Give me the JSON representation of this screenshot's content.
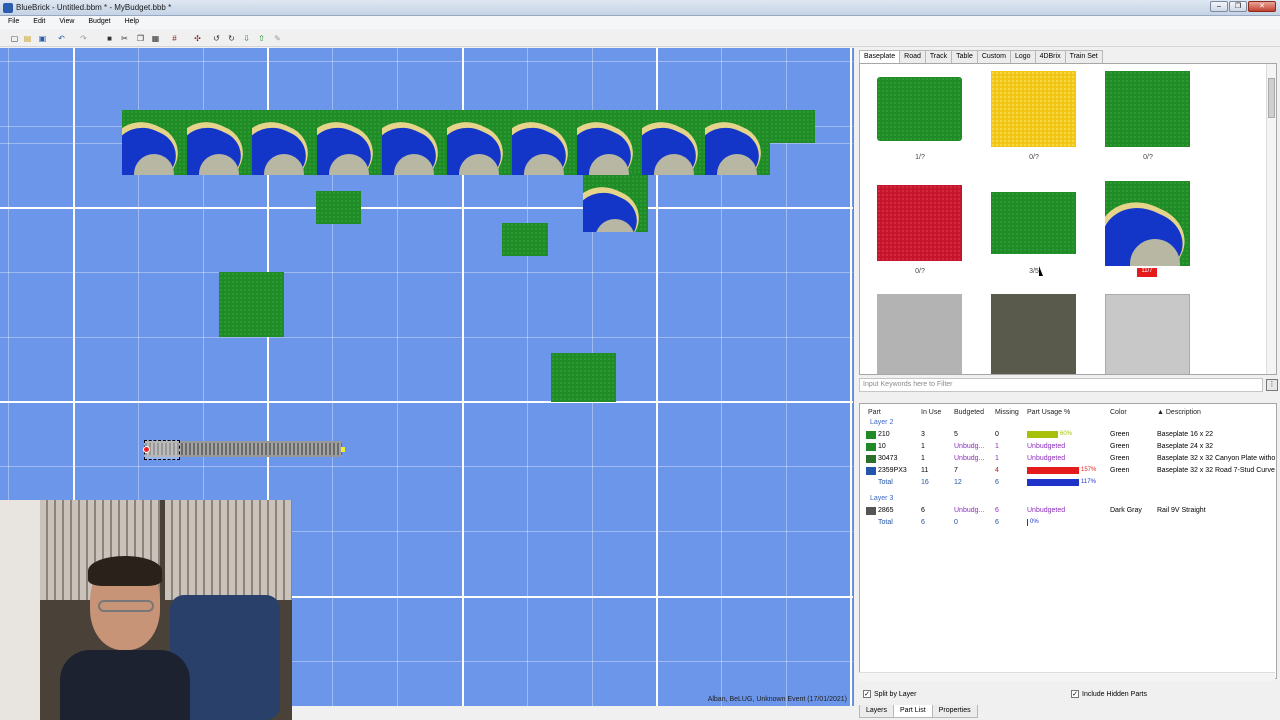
{
  "window": {
    "title": "BlueBrick - Untitled.bbm * - MyBudget.bbb *",
    "buttons": [
      "–",
      "❐",
      "✕"
    ]
  },
  "menu": [
    "File",
    "Edit",
    "View",
    "Budget",
    "Help"
  ],
  "toolbar_icons": [
    "new-icon",
    "open-icon",
    "save-icon",
    "undo-icon",
    "redo-icon",
    "delete-icon",
    "cut-icon",
    "copy-icon",
    "paste-icon",
    "snap-grid-icon",
    "rotate-left-icon",
    "rotate-right-icon",
    "send-back-icon",
    "bring-front-icon",
    "paint-icon"
  ],
  "canvas": {
    "status": "Alban, BeLUG, Unknown Event (17/01/2021)"
  },
  "library": {
    "tabs": [
      "Baseplate",
      "Road",
      "Track",
      "Table",
      "Custom",
      "Logo",
      "4DBrix",
      "Train Set"
    ],
    "active_tab": "Baseplate",
    "items": [
      {
        "label": "1/?",
        "color": "#1f8a26"
      },
      {
        "label": "0/?",
        "color": "#f1c40f"
      },
      {
        "label": "0/?",
        "color": "#1f8a26"
      },
      {
        "label": "0/?",
        "color": "#c4132b"
      },
      {
        "label": "3/5",
        "color": "#1f8a26"
      },
      {
        "label": "11/7",
        "color": "canyon"
      },
      {
        "label": "",
        "color": "#b3b3b3"
      },
      {
        "label": "",
        "color": "#5a5a4c"
      },
      {
        "label": "",
        "color": "#c8c8c8"
      }
    ],
    "filter_placeholder": "Input Keywords here to Filter"
  },
  "part_list": {
    "headers": [
      "Part",
      "In Use",
      "Budgeted",
      "Missing",
      "Part Usage %",
      "Color",
      "▲ Description"
    ],
    "layers": [
      {
        "name": "Layer 2",
        "rows": [
          {
            "part": "210",
            "in_use": "3",
            "budgeted": "5",
            "missing": "0",
            "usage_label": "60%",
            "usage_pct": 60,
            "usage_color": "#a7c10a",
            "budget_state": "ok",
            "color": "Green",
            "description": "Baseplate 16 x 22",
            "icon": "#1f8a26"
          },
          {
            "part": "10",
            "in_use": "1",
            "budgeted": "Unbudg...",
            "missing": "1",
            "usage_label": "Unbudgeted",
            "usage_pct": 0,
            "usage_color": "",
            "budget_state": "unbudgeted",
            "color": "Green",
            "description": "Baseplate 24 x 32",
            "icon": "#1f8a26"
          },
          {
            "part": "30473",
            "in_use": "1",
            "budgeted": "Unbudg...",
            "missing": "1",
            "usage_label": "Unbudgeted",
            "usage_pct": 0,
            "usage_color": "",
            "budget_state": "unbudgeted",
            "color": "Green",
            "description": "Baseplate 32 x 32 Canyon Plate witho",
            "icon": "#2a6f2a"
          },
          {
            "part": "2359PX3",
            "in_use": "11",
            "budgeted": "7",
            "missing": "4",
            "usage_label": "157%",
            "usage_pct": 157,
            "usage_color": "#e51b1b",
            "budget_state": "over",
            "color": "Green",
            "description": "Baseplate 32 x 32 Road 7-Stud Curve",
            "icon": "#2356a8"
          },
          {
            "part": "Total",
            "in_use": "16",
            "budgeted": "12",
            "missing": "6",
            "usage_label": "117%",
            "usage_pct": 117,
            "usage_color": "#1f33c9",
            "budget_state": "total",
            "color": "",
            "description": "",
            "icon": ""
          }
        ]
      },
      {
        "name": "Layer 3",
        "rows": [
          {
            "part": "2865",
            "in_use": "6",
            "budgeted": "Unbudg...",
            "missing": "6",
            "usage_label": "Unbudgeted",
            "usage_pct": 0,
            "usage_color": "",
            "budget_state": "unbudgeted",
            "color": "Dark Gray",
            "description": "Rail 9V Straight",
            "icon": "#555555"
          },
          {
            "part": "Total",
            "in_use": "6",
            "budgeted": "0",
            "missing": "6",
            "usage_label": "0%",
            "usage_pct": 0,
            "usage_color": "",
            "budget_state": "total",
            "color": "",
            "description": "",
            "icon": ""
          }
        ]
      }
    ]
  },
  "options": {
    "split_by_layer": {
      "label": "Split by Layer",
      "checked": true
    },
    "include_hidden": {
      "label": "Include Hidden Parts",
      "checked": true
    }
  },
  "bottom_tabs": [
    "Layers",
    "Part List",
    "Properties"
  ],
  "active_bottom_tab": "Part List"
}
